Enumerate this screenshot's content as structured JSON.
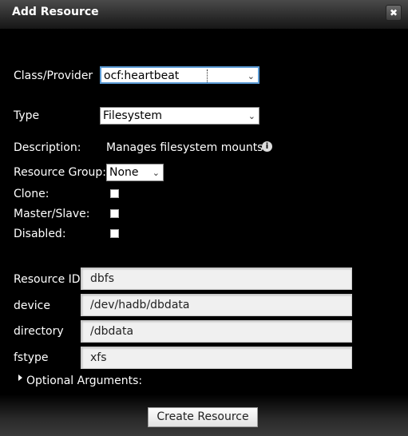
{
  "dialog": {
    "title": "Add Resource",
    "close_glyph": "✖"
  },
  "form": {
    "class_provider": {
      "label": "Class/Provider",
      "value": "ocf:heartbeat"
    },
    "type": {
      "label": "Type",
      "value": "Filesystem"
    },
    "description": {
      "label": "Description:",
      "value": "Manages filesystem mounts"
    },
    "resource_group": {
      "label": "Resource Group:",
      "value": "None"
    },
    "clone": {
      "label": "Clone:",
      "checked": false
    },
    "master_slave": {
      "label": "Master/Slave:",
      "checked": false
    },
    "disabled": {
      "label": "Disabled:",
      "checked": false
    },
    "resource_id": {
      "label": "Resource ID",
      "value": "dbfs"
    },
    "device": {
      "label": "device",
      "value": "/dev/hadb/dbdata"
    },
    "directory": {
      "label": "directory",
      "value": "/dbdata"
    },
    "fstype": {
      "label": "fstype",
      "value": "xfs"
    },
    "optional_arguments": {
      "label": "Optional Arguments:"
    }
  },
  "footer": {
    "create_label": "Create Resource"
  },
  "icons": {
    "info": "info-icon",
    "expand": "triangle-right-icon",
    "dropdown": "chevron-down-icon",
    "close": "close-icon"
  }
}
